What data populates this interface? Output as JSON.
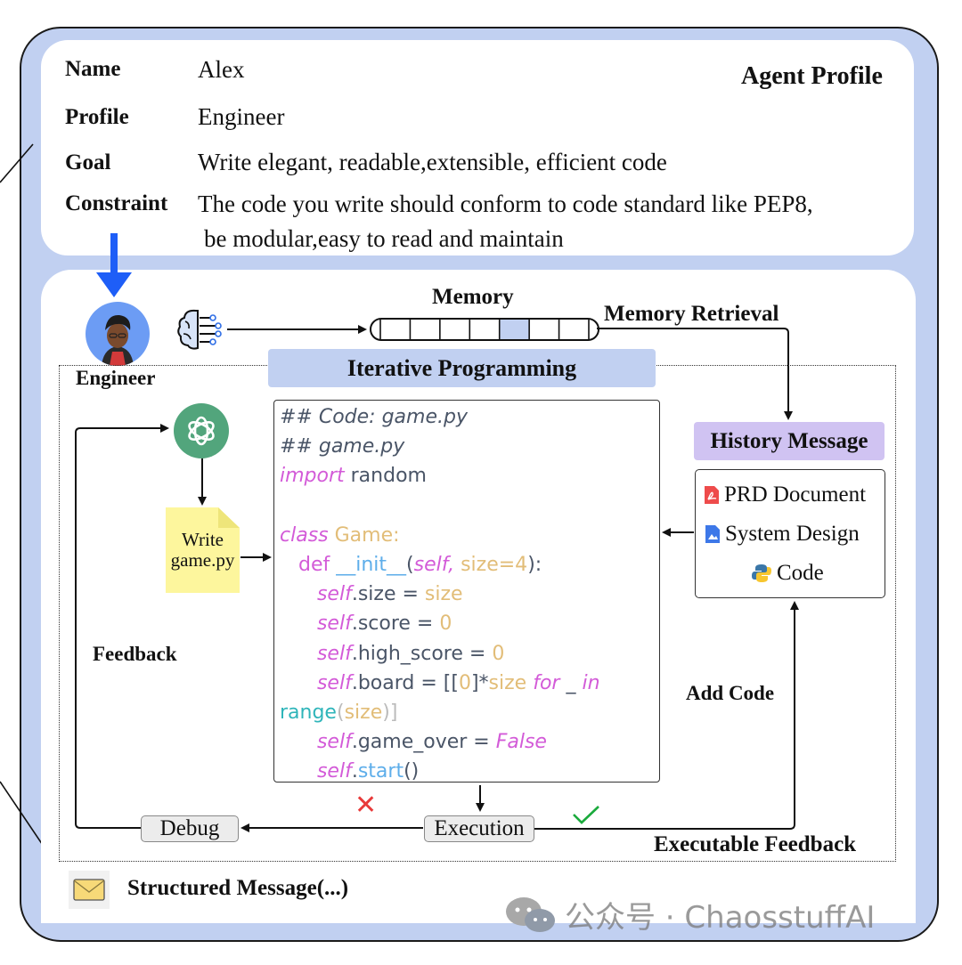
{
  "agent_profile": {
    "title": "Agent Profile",
    "fields": [
      {
        "label": "Name",
        "value": "Alex"
      },
      {
        "label": "Profile",
        "value": "Engineer"
      },
      {
        "label": "Goal",
        "value": "Write elegant, readable,extensible, efficient code"
      },
      {
        "label": "Constraint",
        "value": "The code you write should conform to code standard like PEP8,",
        "value_line2": "be modular,easy to read and maintain"
      }
    ]
  },
  "engineer": {
    "label": "Engineer",
    "icon": "engineer-avatar"
  },
  "memory": {
    "label": "Memory",
    "retrieval_label": "Memory Retrieval",
    "cells": 7,
    "highlighted_cell": 5
  },
  "iterative_programming": {
    "title": "Iterative Programming",
    "write_note": [
      "Write",
      "game.py"
    ],
    "feedback_label": "Feedback",
    "add_code_label": "Add Code",
    "executable_feedback_label": "Executable Feedback",
    "debug_label": "Debug",
    "execution_label": "Execution",
    "fail_symbol": "✕",
    "success_symbol": "✓"
  },
  "code_lines": [
    "## Code: game.py",
    "## game.py",
    "import random",
    "",
    "class Game:",
    "def __init__(self, size=4):",
    "self.size = size",
    "self.score = 0",
    "self.high_score = 0",
    "self.board = [[0]*size for _ in",
    "range(size)]",
    "self.game_over = False",
    "self.start()"
  ],
  "history_message": {
    "title": "History Message",
    "items": [
      {
        "icon": "pdf-icon",
        "label": "PRD Document"
      },
      {
        "icon": "image-doc-icon",
        "label": "System Design"
      },
      {
        "icon": "python-icon",
        "label": "Code"
      }
    ]
  },
  "structured_message": {
    "label": "Structured Message(...)",
    "icon": "envelope-icon"
  },
  "watermark": {
    "text": "公众号 · ChaosstuffAI"
  },
  "colors": {
    "panel_blue": "#c1d0f1",
    "history_purple": "#d0c3f2",
    "arrow_blue": "#1e5ef7",
    "gpt_green": "#52a57c",
    "note_yellow": "#fdf69d",
    "fail_red": "#e83a3a",
    "success_green": "#1aaa3c"
  }
}
